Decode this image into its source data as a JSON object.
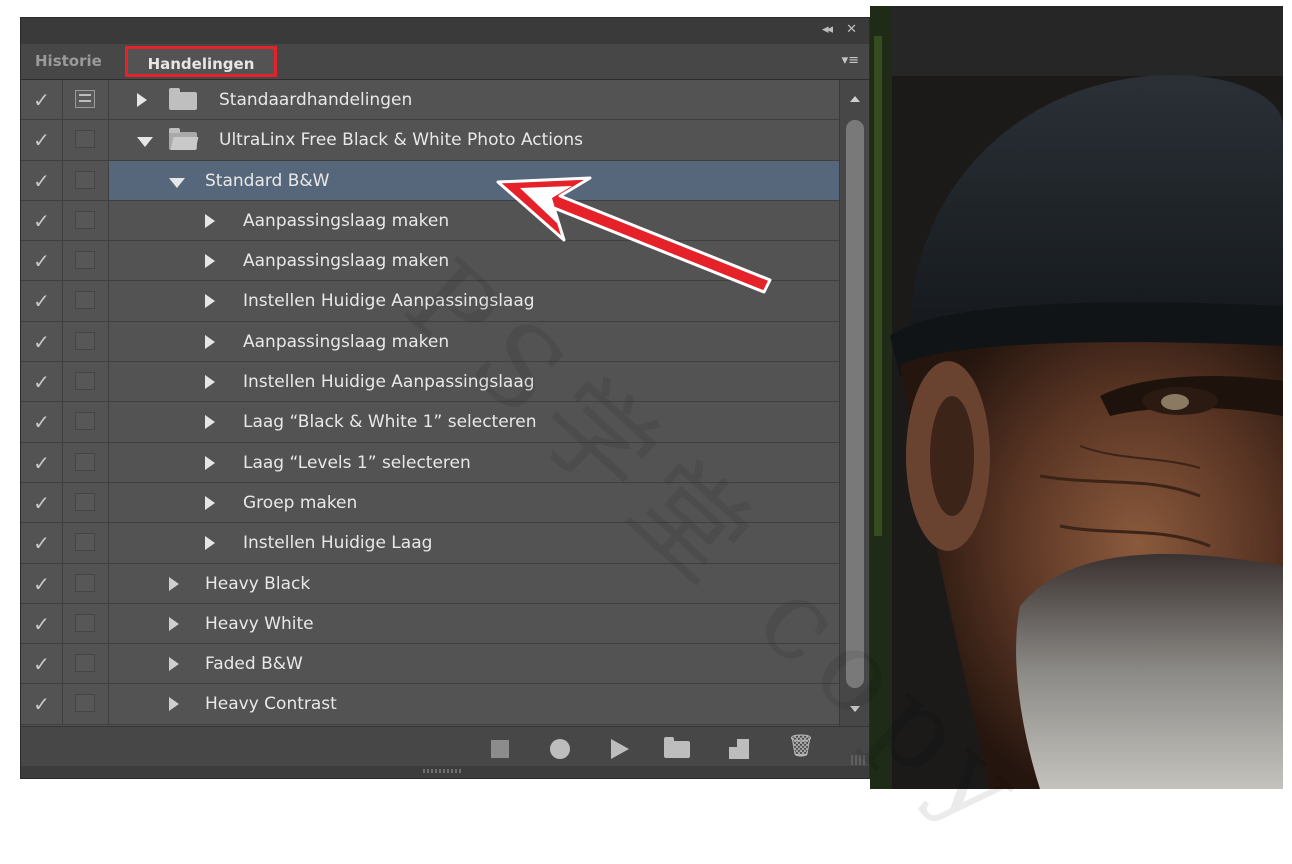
{
  "panel": {
    "titlebar": {
      "collapse_glyph": "◂◂",
      "close_glyph": "✕"
    },
    "tabs": [
      {
        "label": "Historie",
        "active": false
      },
      {
        "label": "Handelingen",
        "active": true
      }
    ],
    "panel_menu_glyph": "▾≡",
    "rows": [
      {
        "label": "Standaardhandelingen",
        "level": 0,
        "type": "set",
        "expanded": false,
        "checked": true,
        "dialog": true
      },
      {
        "label": "UltraLinx Free Black & White Photo Actions",
        "level": 0,
        "type": "set",
        "expanded": true,
        "checked": true,
        "dialog": false
      },
      {
        "label": "Standard B&W",
        "level": 1,
        "type": "action",
        "expanded": true,
        "checked": true,
        "dialog": false,
        "selected": true
      },
      {
        "label": "Aanpassingslaag maken",
        "level": 2,
        "type": "step",
        "checked": true,
        "dialog": false
      },
      {
        "label": "Aanpassingslaag maken",
        "level": 2,
        "type": "step",
        "checked": true,
        "dialog": false
      },
      {
        "label": "Instellen  Huidige Aanpassingslaag",
        "level": 2,
        "type": "step",
        "checked": true,
        "dialog": false
      },
      {
        "label": "Aanpassingslaag maken",
        "level": 2,
        "type": "step",
        "checked": true,
        "dialog": false
      },
      {
        "label": "Instellen  Huidige Aanpassingslaag",
        "level": 2,
        "type": "step",
        "checked": true,
        "dialog": false
      },
      {
        "label": "Laag “Black & White 1” selecteren",
        "level": 2,
        "type": "step",
        "checked": true,
        "dialog": false
      },
      {
        "label": "Laag “Levels 1” selecteren",
        "level": 2,
        "type": "step",
        "checked": true,
        "dialog": false
      },
      {
        "label": "Groep maken",
        "level": 2,
        "type": "step",
        "checked": true,
        "dialog": false
      },
      {
        "label": "Instellen  Huidige Laag",
        "level": 2,
        "type": "step",
        "checked": true,
        "dialog": false
      },
      {
        "label": "Heavy Black",
        "level": 1,
        "type": "action",
        "expanded": false,
        "checked": true,
        "dialog": false
      },
      {
        "label": "Heavy White",
        "level": 1,
        "type": "action",
        "expanded": false,
        "checked": true,
        "dialog": false
      },
      {
        "label": "Faded B&W",
        "level": 1,
        "type": "action",
        "expanded": false,
        "checked": true,
        "dialog": false
      },
      {
        "label": "Heavy Contrast",
        "level": 1,
        "type": "action",
        "expanded": false,
        "checked": true,
        "dialog": false
      }
    ],
    "toolbar": {
      "icons": [
        "stop-icon",
        "record-icon",
        "play-icon",
        "new-set-icon",
        "new-action-icon",
        "trash-icon"
      ],
      "trash_glyph": "🗑"
    }
  },
  "colors": {
    "panel_bg": "#535353",
    "selected_row": "#56677b",
    "tab_highlight": "#e5212a",
    "annotation_arrow": "#e5212a"
  },
  "icons": {
    "checkmark": "✓",
    "checkmark_icon": "checkmark-icon",
    "dialog_toggle_icon": "dialog-toggle-icon",
    "folder_icon": "folder-icon",
    "disclosure_icon": "disclosure-triangle-icon"
  },
  "watermark": "PS学堂 copy"
}
